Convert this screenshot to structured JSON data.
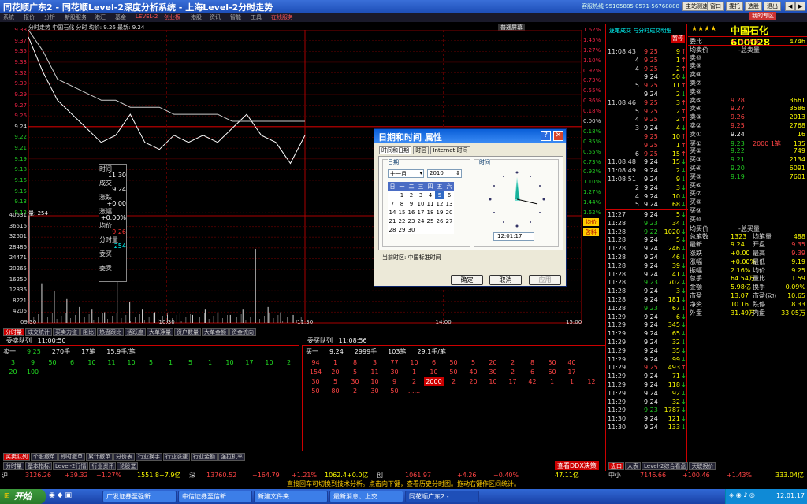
{
  "app": {
    "title": "同花顺广东2 - 同花顺Level-2深度分析系统 - 上海Level-2分时走势",
    "hotline": "客服热线 95105885 0571-56768888",
    "buttons": [
      "主站测速",
      "窗口",
      "委托",
      "选股",
      "退出",
      "◀",
      "▶"
    ],
    "right_button": "我的专区"
  },
  "menu": [
    "系统",
    "报价",
    "分析",
    "新股服务",
    "港汇",
    "基金",
    "LEVEL-2",
    "创业板",
    "港股",
    "资讯",
    "智能",
    "工具",
    "在线服务"
  ],
  "chart": {
    "header": "分时走势",
    "stock": "中国石化",
    "mode": "分时",
    "avg_label": "均价: 9.26",
    "latest_label": "最新: 9.24",
    "screen_btn": "普通屏幕",
    "price_ticks": [
      "9.38",
      "9.37",
      "9.35",
      "9.33",
      "9.32",
      "9.30",
      "9.29",
      "9.27",
      "9.26",
      "9.24",
      "9.22",
      "9.21",
      "9.19",
      "9.18",
      "9.16",
      "9.15",
      "9.13",
      "9.12"
    ],
    "pct_ticks": [
      "1.62%",
      "1.45%",
      "1.27%",
      "1.10%",
      "0.92%",
      "0.73%",
      "0.55%",
      "0.36%",
      "0.18%",
      "0.00%",
      "0.18%",
      "0.35%",
      "0.55%",
      "0.73%",
      "0.92%",
      "1.10%",
      "1.27%",
      "1.44%",
      "1.62%"
    ],
    "vol_label": "量: 254",
    "vol_ticks": [
      "40531",
      "36516",
      "32501",
      "28486",
      "24471",
      "20265",
      "16250",
      "12336",
      "8221",
      "4206"
    ],
    "time_ticks": [
      "09:30",
      "10:30",
      "11:30",
      "14:00",
      "15:00"
    ],
    "buttons": [
      "均价",
      "答料"
    ]
  },
  "chart_data": {
    "type": "line",
    "title": "",
    "x_ticks": [
      "09:30",
      "10:30",
      "11:30",
      "14:00",
      "15:00"
    ],
    "series": [
      {
        "name": "",
        "values": [
          9.38,
          9.35,
          9.31,
          9.3,
          9.29,
          9.28,
          9.28,
          9.27,
          9.27,
          9.27,
          9.26,
          9.26,
          9.26,
          9.26,
          9.25,
          9.25,
          9.25,
          9.25,
          9.25,
          9.25
        ]
      },
      {
        "name": "",
        "values": [
          9.37,
          9.32,
          9.28,
          9.26,
          9.24,
          9.22,
          9.23,
          9.26,
          9.22,
          9.21,
          9.23,
          9.22,
          9.23,
          9.22,
          9.24,
          9.26,
          9.23,
          9.22,
          9.19,
          9.23
        ]
      }
    ],
    "volumes": [
      40531,
      15000,
      12000,
      9000,
      6000,
      5000,
      4000,
      16000,
      8000,
      5000,
      4000,
      3000,
      3500,
      3000,
      5000,
      4000,
      3000,
      5000,
      28000,
      6000,
      4000,
      3000
    ],
    "ylim": [
      9.12,
      9.38
    ]
  },
  "tooltip": {
    "items": [
      [
        "时间",
        "11:30"
      ],
      [
        "成交",
        "9.24"
      ],
      [
        "涨跌",
        "+0.00"
      ],
      [
        "涨幅",
        "+0.00%"
      ],
      [
        "均价",
        "9.26"
      ],
      [
        "分时量",
        "254"
      ],
      [
        "委买",
        ""
      ],
      [
        "委卖",
        ""
      ]
    ]
  },
  "lowertabs1": [
    "分时量",
    "成交统计",
    "买卖力道",
    "阻比",
    "热盘跟比",
    "活跃度",
    "大单净量",
    "资户数量",
    "大单金额",
    "资金流向"
  ],
  "queues": {
    "sell_title": "委卖队列",
    "sell_time": "11:00:50",
    "buy_title": "委买队列",
    "buy_time": "11:08:56",
    "sell_summary": [
      "卖一",
      "9.25",
      "270手",
      "17笔",
      "15.9手/笔"
    ],
    "buy_summary": [
      "买一",
      "9.24",
      "2999手",
      "103笔",
      "29.1手/笔"
    ],
    "sell_rows": [
      [
        "3",
        "9",
        "50",
        "6",
        "10",
        "11",
        "10",
        "5",
        "1",
        "5",
        "1",
        "10",
        "17",
        "10",
        "2"
      ],
      [
        "20",
        "100"
      ]
    ],
    "buy_rows": [
      [
        "94",
        "1",
        "8",
        "3",
        "77",
        "10",
        "6",
        "50",
        "5",
        "20",
        "2",
        "8",
        "50",
        "40"
      ],
      [
        "154",
        "20",
        "5",
        "11",
        "30",
        "1",
        "10",
        "50",
        "40",
        "30",
        "2",
        "6",
        "60",
        "17"
      ],
      [
        "30",
        "5",
        "30",
        "10",
        "9",
        "2",
        "2000",
        "2",
        "20",
        "10",
        "17",
        "42",
        "1",
        "1",
        "12"
      ],
      [
        "50",
        "80",
        "2",
        "30",
        "50",
        "......"
      ]
    ]
  },
  "lowertabs2": [
    "买卖队列",
    "个股撤单",
    "即时撤单",
    "累计撤单",
    "分价表",
    "行业换手",
    "行业涨速",
    "行业金额",
    "强拉机率"
  ],
  "lowertabs3": [
    "分时量",
    "基本指标",
    "Level-2行情",
    "行业资讯",
    "论股堂"
  ],
  "panel": {
    "title_stars": "★★★★",
    "name": "中国石化",
    "code": "600028",
    "ratio": [
      "委比",
      "+15.59%",
      "4746"
    ],
    "header1": [
      "均卖价",
      "-总卖量"
    ],
    "sells": [
      [
        "卖⑩",
        "",
        ""
      ],
      [
        "卖⑨",
        "",
        ""
      ],
      [
        "卖⑧",
        "",
        ""
      ],
      [
        "卖⑦",
        "",
        ""
      ],
      [
        "卖⑥",
        "",
        ""
      ],
      [
        "卖⑤",
        "9.28",
        "3661"
      ],
      [
        "卖④",
        "9.27",
        "3586"
      ],
      [
        "卖③",
        "9.26",
        "2013"
      ],
      [
        "卖②",
        "9.25",
        "2768"
      ],
      [
        "卖①",
        "9.24",
        "16"
      ]
    ],
    "buys": [
      [
        "买①",
        "9.23",
        "2000 1笔",
        "135"
      ],
      [
        "买②",
        "9.22",
        "",
        "749"
      ],
      [
        "买③",
        "9.21",
        "",
        "2134"
      ],
      [
        "买④",
        "9.20",
        "",
        "6091"
      ],
      [
        "买⑤",
        "9.19",
        "",
        "7601"
      ],
      [
        "买⑥",
        "",
        "",
        ""
      ],
      [
        "买⑦",
        "",
        "",
        ""
      ],
      [
        "买⑧",
        "",
        "",
        ""
      ],
      [
        "买⑨",
        "",
        "",
        ""
      ],
      [
        "买⑩",
        "",
        "",
        ""
      ]
    ],
    "header2": [
      "均买价",
      "-总买量"
    ],
    "stats": [
      [
        "总笔数",
        "1323",
        "均笔量",
        "488"
      ],
      [
        "最新",
        "9.24",
        "开盘",
        "9.35"
      ],
      [
        "涨跌",
        "+0.00",
        "最高",
        "9.39"
      ],
      [
        "涨幅",
        "+0.00%",
        "最低",
        "9.19"
      ],
      [
        "振幅",
        "2.16%",
        "均价",
        "9.25"
      ],
      [
        "总手",
        "64.54万",
        "量比",
        "1.59"
      ],
      [
        "金额",
        "5.98亿",
        "换手",
        "0.09%"
      ],
      [
        "市盈",
        "13.07",
        "市盈(动)",
        "10.65"
      ],
      [
        "净资",
        "10.16",
        "跌停",
        "8.33"
      ],
      [
        "外盘",
        "31.49万",
        "内盘",
        "33.05万"
      ]
    ],
    "bottom_tabs": [
      "盘口",
      "大表",
      "Level-2综合看盘",
      "天联报价"
    ],
    "ddx": "查看DDX决策"
  },
  "ticks_title": "逐笔成交 与分时成交明细",
  "ticks_btn": "暂停",
  "ticks_top": [
    [
      "11:08:43",
      "9.25",
      "9"
    ],
    [
      "4",
      "9.25",
      "1"
    ],
    [
      "4",
      "9.25",
      "2"
    ],
    [
      "",
      "9.24",
      "50"
    ],
    [
      "5",
      "9.25",
      "11"
    ],
    [
      "",
      "9.24",
      "2"
    ],
    [
      "11:08:46",
      "9.25",
      "3"
    ],
    [
      "5",
      "9.25",
      "2"
    ],
    [
      "4",
      "9.25",
      "2"
    ],
    [
      "3",
      "9.24",
      "4"
    ],
    [
      "",
      "9.25",
      "10"
    ],
    [
      "",
      "9.25",
      "1"
    ],
    [
      "6",
      "9.25",
      "15"
    ],
    [
      "11:08:48",
      "9.24",
      "15"
    ],
    [
      "11:08:49",
      "9.24",
      "2"
    ],
    [
      "11:08:51",
      "9.24",
      "9"
    ],
    [
      "2",
      "9.24",
      "3"
    ],
    [
      "4",
      "9.24",
      "10"
    ],
    [
      "5",
      "9.24",
      "68"
    ]
  ],
  "ticks_bot": [
    [
      "11:27",
      "9.24",
      "5"
    ],
    [
      "11:28",
      "9.23",
      "34"
    ],
    [
      "11:28",
      "9.22",
      "1020"
    ],
    [
      "11:28",
      "9.24",
      "5"
    ],
    [
      "11:28",
      "9.24",
      "246"
    ],
    [
      "11:28",
      "9.24",
      "46"
    ],
    [
      "11:28",
      "9.24",
      "39"
    ],
    [
      "11:28",
      "9.24",
      "41"
    ],
    [
      "11:28",
      "9.23",
      "702"
    ],
    [
      "11:28",
      "9.24",
      "3"
    ],
    [
      "11:28",
      "9.24",
      "181"
    ],
    [
      "11:28",
      "9.23",
      "67"
    ],
    [
      "11:29",
      "9.24",
      "6"
    ],
    [
      "11:29",
      "9.24",
      "345"
    ],
    [
      "11:29",
      "9.24",
      "65"
    ],
    [
      "11:29",
      "9.24",
      "32"
    ],
    [
      "11:29",
      "9.24",
      "35"
    ],
    [
      "11:29",
      "9.24",
      "99"
    ],
    [
      "11:29",
      "9.25",
      "493"
    ],
    [
      "11:29",
      "9.24",
      "71"
    ],
    [
      "11:29",
      "9.24",
      "118"
    ],
    [
      "11:29",
      "9.24",
      "92"
    ],
    [
      "11:29",
      "9.24",
      "32"
    ],
    [
      "11:29",
      "9.23",
      "1787"
    ],
    [
      "11:30",
      "9.24",
      "121"
    ],
    [
      "11:30",
      "9.24",
      "133"
    ]
  ],
  "index_bar": {
    "sh": [
      "沪",
      "3126.26",
      "+39.32",
      "+1.27%",
      "1551.8+7.9亿",
      "深",
      "13760.52",
      "+164.79",
      "+1.21%",
      "1062.4+0.0亿",
      "创",
      "1061.97",
      "+4.26",
      "+0.40%",
      "47.11亿"
    ],
    "zx": [
      "中小",
      "7146.66",
      "+100.46",
      "+1.43%",
      "333.04亿"
    ]
  },
  "scroll_msg": "直接回车可切换到技术分析。点击向下键，查看历史分时图。拖动右键作区间统计。",
  "dialog": {
    "title": "日期和时间 属性",
    "tabs": [
      "时间和日期",
      "时区",
      "Internet 时间"
    ],
    "date_label": "日期",
    "month": "十一月",
    "year": "2010",
    "weekdays": [
      "日",
      "一",
      "二",
      "三",
      "四",
      "五",
      "六"
    ],
    "days": [
      [
        "",
        "1",
        "2",
        "3",
        "4",
        "5",
        "6"
      ],
      [
        "7",
        "8",
        "9",
        "10",
        "11",
        "12",
        "13"
      ],
      [
        "14",
        "15",
        "16",
        "17",
        "18",
        "19",
        "20"
      ],
      [
        "21",
        "22",
        "23",
        "24",
        "25",
        "26",
        "27"
      ],
      [
        "28",
        "29",
        "30",
        "",
        "",
        "",
        ""
      ]
    ],
    "time_label": "时间",
    "time": "12:01:17",
    "tz": "当前时区: 中国标准时间",
    "ok": "确定",
    "cancel": "取消",
    "apply": "应用"
  },
  "taskbar": {
    "start": "开始",
    "tasks": [
      "广发证券至强新...",
      "中信证券至信新...",
      "新建文件夹",
      "最新消息、上交...",
      "同花顺广东2 -..."
    ],
    "clock": "12:01:17"
  }
}
